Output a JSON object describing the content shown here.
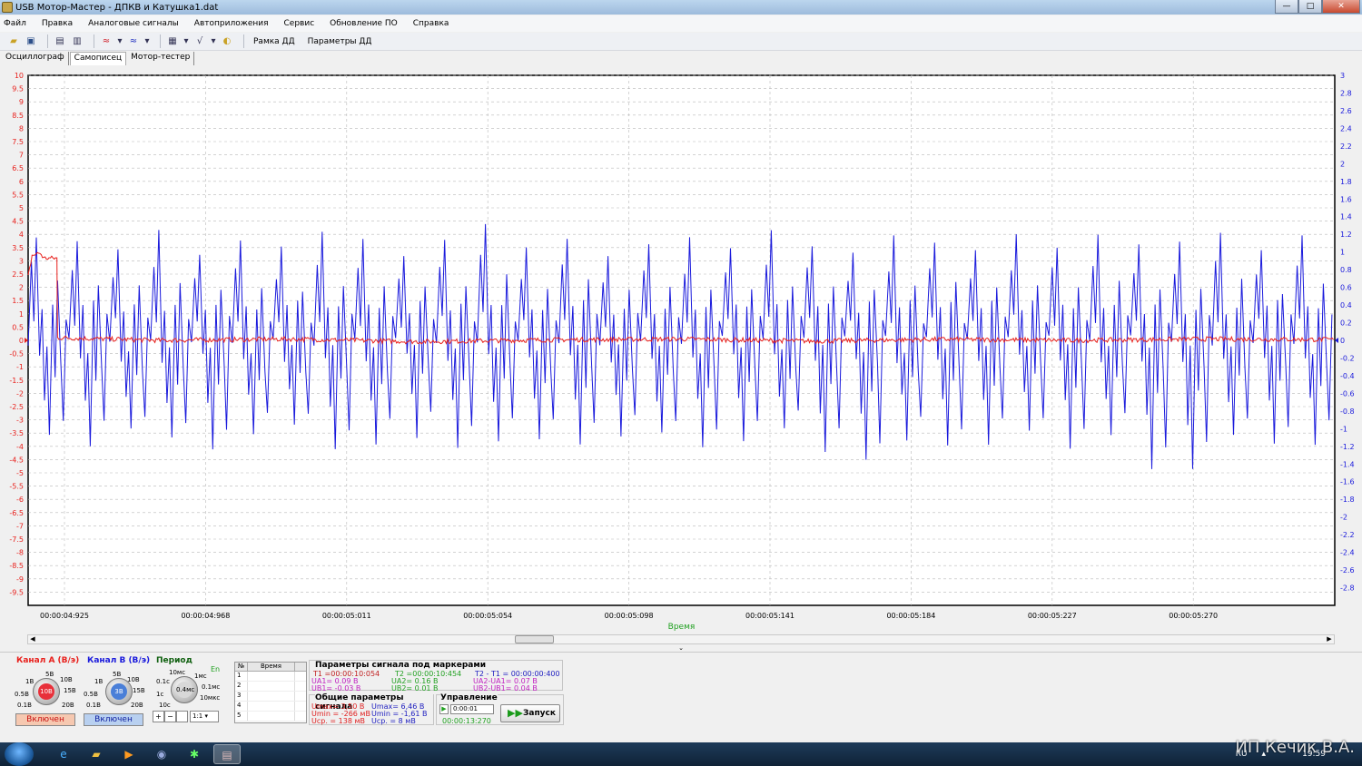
{
  "window": {
    "title": "USB Мотор-Мастер - ДПКВ и Катушка1.dat",
    "minimize": "—",
    "maximize": "□",
    "close": "✕"
  },
  "menu": [
    "Файл",
    "Правка",
    "Аналоговые сигналы",
    "Автоприложения",
    "Сервис",
    "Обновление ПО",
    "Справка"
  ],
  "toolbar": {
    "ramka_label": "Рамка ДД",
    "params_label": "Параметры ДД"
  },
  "tabs": [
    "Осциллограф",
    "Самописец",
    "Мотор-тестер"
  ],
  "active_tab": "Самописец",
  "chart_data": {
    "type": "line",
    "xlabel": "Время",
    "x_ticks": [
      "00:00:04:925",
      "00:00:04:968",
      "00:00:05:011",
      "00:00:05:054",
      "00:00:05:098",
      "00:00:05:141",
      "00:00:05:184",
      "00:00:05:227",
      "00:00:05:270"
    ],
    "y_left_ticks": [
      "10",
      "9.5",
      "9",
      "8.5",
      "8",
      "7.5",
      "7",
      "6.5",
      "6",
      "5.5",
      "5",
      "4.5",
      "4",
      "3.5",
      "3",
      "2.5",
      "2",
      "1.5",
      "1",
      "0.5",
      "0",
      "-0.5",
      "-1",
      "-1.5",
      "-2",
      "-2.5",
      "-3",
      "-3.5",
      "-4",
      "-4.5",
      "-5",
      "-5.5",
      "-6",
      "-6.5",
      "-7",
      "-7.5",
      "-8",
      "-8.5",
      "-9",
      "-9.5"
    ],
    "y_right_ticks": [
      "3",
      "2.8",
      "2.6",
      "2.4",
      "2.2",
      "2",
      "1.8",
      "1.6",
      "1.4",
      "1.2",
      "1",
      "0.8",
      "0.6",
      "0.4",
      "0.2",
      "0",
      "-0.2",
      "-0.4",
      "-0.6",
      "-0.8",
      "-1",
      "-1.2",
      "-1.4",
      "-1.6",
      "-1.8",
      "-2",
      "-2.2",
      "-2.4",
      "-2.6",
      "-2.8"
    ],
    "ylim_left": [
      -10,
      10
    ],
    "ylim_right": [
      -3,
      3
    ],
    "grid": true,
    "colors": {
      "channel_a": "#e8201c",
      "channel_b": "#1a1adc",
      "left_axis": "#e8201c",
      "right_axis": "#1a1adc"
    },
    "series": [
      {
        "channel": "a",
        "axis": "left",
        "color": "#e8201c",
        "points": [
          [
            0,
            2.4
          ],
          [
            0.3,
            3.2
          ],
          [
            0.9,
            3.3
          ],
          [
            1.2,
            3.1
          ],
          [
            2.2,
            3.1
          ],
          [
            2.25,
            0.1
          ],
          [
            10,
            0.0
          ],
          [
            20,
            0.05
          ],
          [
            30,
            -0.05
          ],
          [
            40,
            0.02
          ],
          [
            50,
            0.05
          ],
          [
            60,
            -0.03
          ],
          [
            70,
            0.04
          ],
          [
            80,
            0.0
          ],
          [
            90,
            0.05
          ],
          [
            100,
            0.03
          ]
        ]
      },
      {
        "channel": "b",
        "axis": "right",
        "color": "#1a1adc",
        "peaks": [
          1.2,
          1.1,
          1.05,
          1.2,
          1.0,
          1.15,
          1.05,
          1.2,
          1.1,
          1.0,
          1.15,
          1.3,
          1.05,
          1.2,
          1.0,
          1.1,
          1.15,
          1.05,
          1.2,
          1.1,
          1.0,
          1.2,
          1.15,
          1.05,
          1.2,
          1.1,
          1.25,
          1.05,
          1.1,
          1.2,
          1.0,
          1.15
        ],
        "troughs": [
          -1.1,
          -1.2,
          -1.05,
          -1.15,
          -1.25,
          -1.1,
          -1.0,
          -1.2,
          -1.15,
          -1.05,
          -1.2,
          -1.1,
          -1.15,
          -1.2,
          -1.05,
          -1.1,
          -1.2,
          -1.15,
          -1.05,
          -1.3,
          -1.4,
          -1.1,
          -1.2,
          -1.15,
          -1.05,
          -1.2,
          -1.1,
          -1.45,
          -1.5,
          -1.1,
          -1.2,
          -1.15
        ]
      }
    ]
  },
  "channel_a": {
    "title": "Канал А (В/э)",
    "value": "10В",
    "labels": [
      "1В",
      "5В",
      "10В",
      "0.5В",
      "15В",
      "0.1В",
      "20В"
    ],
    "button": "Включен"
  },
  "channel_b": {
    "title": "Канал В (В/э)",
    "value": "3В",
    "labels": [
      "1В",
      "5В",
      "10В",
      "0.5В",
      "15В",
      "0.1В",
      "20В"
    ],
    "button": "Включен"
  },
  "period": {
    "title": "Период",
    "value": "0.4мс",
    "labels": [
      "10мс",
      "1мс",
      "0.1с",
      "0.1мс",
      "1с",
      "10мкс",
      "10с"
    ],
    "en": "En",
    "ratio": "1:1"
  },
  "marker_table": {
    "headers": [
      "№",
      "Время"
    ],
    "rows": [
      "1",
      "2",
      "3",
      "4",
      "5"
    ]
  },
  "params": {
    "title": "Параметры сигнала под маркерами",
    "t1": "T1 =00:00:10:054",
    "ua1": "UA1= 0.09 В",
    "ub1": "UB1= -0.03 В",
    "t2": "T2 =00:00:10:454",
    "ua2": "UA2= 0.16 В",
    "ub2": "UB2= 0.01 В",
    "dt": "T2 - T1 = 00:00:00:400",
    "dua": "UA2-UA1= 0.07 В",
    "dub": "UB2-UB1= 0.04 В"
  },
  "general": {
    "title": "Общие параметры сигнала",
    "a_max": "Umax= 3,50 В",
    "a_min": "Umin = -266 мВ",
    "a_avg": "Uср. = 138 мВ",
    "b_max": "Umax= 6,46 В",
    "b_min": "Umin = -1,61 В",
    "b_avg": "Uср. =   8 мВ"
  },
  "control": {
    "title": "Управление",
    "time_field": "0:00:01",
    "elapsed": "00:00:13:270",
    "run_button": "Запуск"
  },
  "taskbar": {
    "lang": "RU",
    "clock": "19:59"
  },
  "watermark": "ИП Кечик В.А."
}
